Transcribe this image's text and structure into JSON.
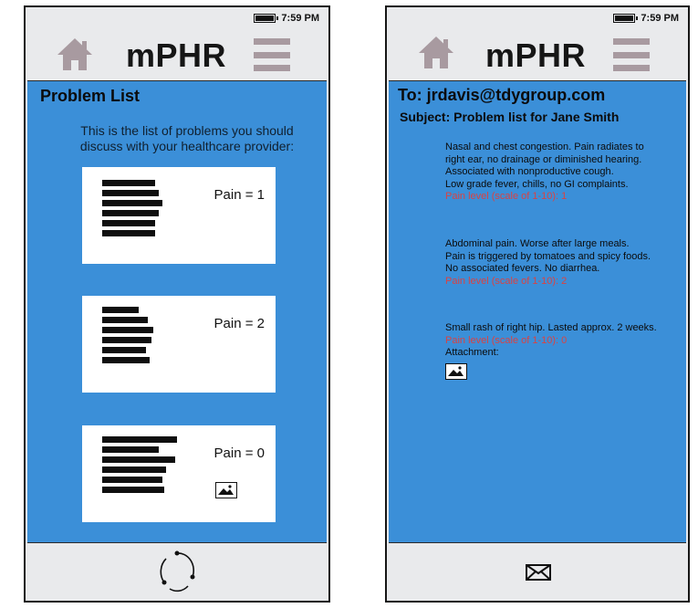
{
  "status_bar": {
    "time": "7:59 PM"
  },
  "app": {
    "title": "mPHR"
  },
  "problem_list_screen": {
    "heading": "Problem List",
    "intro_lines": [
      "This is the list of problems you should",
      "discuss with your healthcare provider:"
    ],
    "cards": [
      {
        "pain_label": "Pain = 1",
        "has_image": false
      },
      {
        "pain_label": "Pain = 2",
        "has_image": false
      },
      {
        "pain_label": "Pain = 0",
        "has_image": true
      }
    ],
    "footer_icon": "refresh-icon"
  },
  "email_screen": {
    "to": "To: jrdavis@tdygroup.com",
    "subject": "Subject: Problem list for Jane Smith",
    "problems": [
      {
        "lines": [
          "Nasal and chest congestion. Pain radiates to",
          "right ear, no drainage or diminished hearing.",
          "Associated with nonproductive cough.",
          "Low grade fever, chills, no GI complaints."
        ],
        "pain_level": "Pain level (scale of 1-10): 1"
      },
      {
        "lines": [
          "Abdominal pain. Worse after large meals.",
          "Pain is triggered by tomatoes and spicy foods.",
          "No associated fevers. No diarrhea."
        ],
        "pain_level": "Pain level (scale of 1-10): 2"
      },
      {
        "lines": [
          "Small rash of right hip. Lasted approx. 2 weeks."
        ],
        "pain_level": "Pain level (scale of 1-10): 0",
        "attachment_label": "Attachment:"
      }
    ],
    "footer_icon": "mail-icon"
  },
  "colors": {
    "screen_blue": "#3b8fd8",
    "frame_gray": "#e9eaec",
    "menu_mauve": "#a89aa0",
    "pain_level_red": "#d94343"
  }
}
